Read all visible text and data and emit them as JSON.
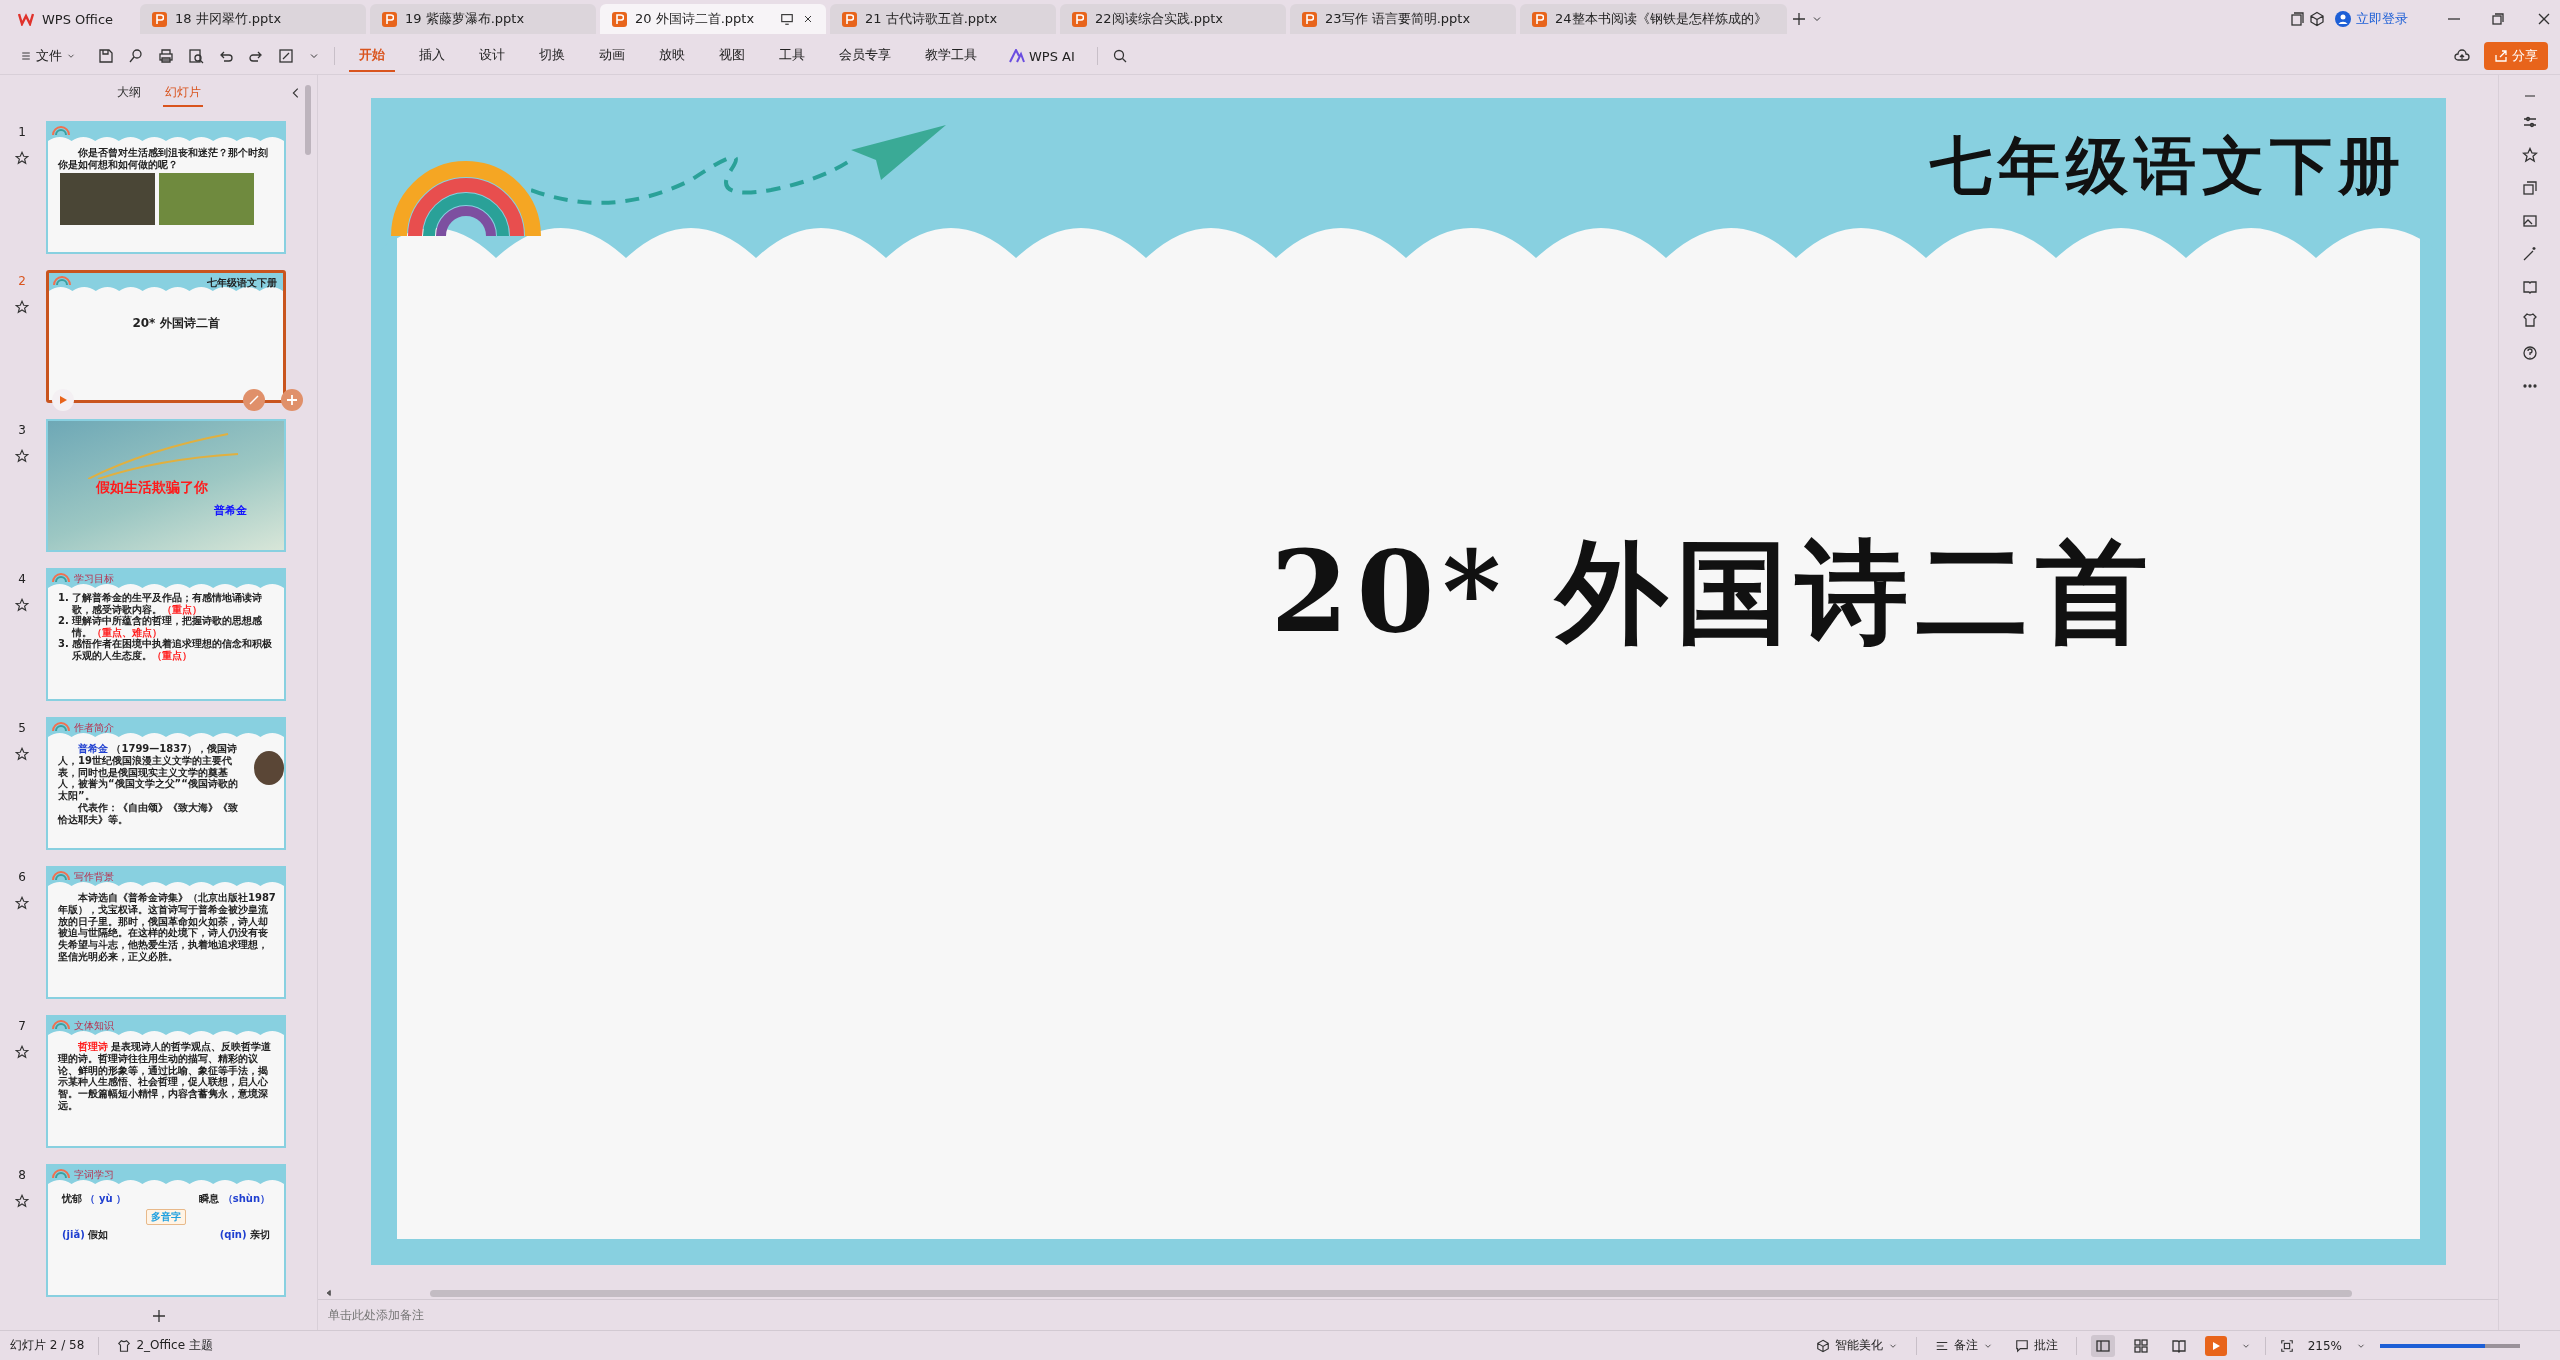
{
  "tabs": [
    {
      "kind": "home",
      "label": "WPS Office",
      "selected": false
    },
    {
      "kind": "pptx",
      "label": "18 井冈翠竹.pptx",
      "selected": false
    },
    {
      "kind": "pptx",
      "label": "19 紫藤萝瀑布.pptx",
      "selected": false
    },
    {
      "kind": "pptx",
      "label": "20 外国诗二首.pptx",
      "selected": true
    },
    {
      "kind": "pptx",
      "label": "21 古代诗歌五首.pptx",
      "selected": false
    },
    {
      "kind": "pptx",
      "label": "22阅读综合实践.pptx",
      "selected": false
    },
    {
      "kind": "pptx",
      "label": "23写作 语言要简明.pptx",
      "selected": false
    },
    {
      "kind": "pptx",
      "label": "24整本书阅读《钢铁是怎样炼成的》",
      "selected": false
    }
  ],
  "account": {
    "label": "立即登录"
  },
  "share_button": {
    "label": "分享"
  },
  "menu": {
    "file": "文件",
    "tabs": [
      {
        "label": "开始",
        "selected": true
      },
      {
        "label": "插入",
        "selected": false
      },
      {
        "label": "设计",
        "selected": false
      },
      {
        "label": "切换",
        "selected": false
      },
      {
        "label": "动画",
        "selected": false
      },
      {
        "label": "放映",
        "selected": false
      },
      {
        "label": "视图",
        "selected": false
      },
      {
        "label": "工具",
        "selected": false
      },
      {
        "label": "会员专享",
        "selected": false
      },
      {
        "label": "教学工具",
        "selected": false
      }
    ],
    "ai": "WPS AI"
  },
  "panel": {
    "tabs": [
      {
        "label": "大纲",
        "selected": false
      },
      {
        "label": "幻灯片",
        "selected": true
      }
    ],
    "slides": [
      {
        "number": "1",
        "kind": "intro",
        "selected": false,
        "text": "你是否曾对生活感到沮丧和迷茫？那个时刻你是如何想和如何做的呢？"
      },
      {
        "number": "2",
        "kind": "title",
        "selected": true,
        "header": "七年级语文下册",
        "title": "20* 外国诗二首"
      },
      {
        "number": "3",
        "kind": "cover",
        "selected": false,
        "title": "假如生活欺骗了你",
        "author": "普希金"
      },
      {
        "number": "4",
        "kind": "objectives",
        "selected": false,
        "header": "学习目标",
        "items": [
          {
            "num": "1.",
            "text": "了解普希金的生平及作品；有感情地诵读诗歌，感受诗歌内容。",
            "note": "（重点）"
          },
          {
            "num": "2.",
            "text": "理解诗中所蕴含的哲理，把握诗歌的思想感情。",
            "note": "（重点、难点）"
          },
          {
            "num": "3.",
            "text": "感悟作者在困境中执着追求理想的信念和积极乐观的人生态度。",
            "note": "（重点）"
          }
        ]
      },
      {
        "number": "5",
        "kind": "text",
        "selected": false,
        "header": "作者简介",
        "portrait": true,
        "paragraphs": [
          {
            "lead": "普希金",
            "color": "#1f3fd0",
            "text": "（1799—1837），俄国诗人，19世纪俄国浪漫主义文学的主要代表，同时也是俄国现实主义文学的奠基人，被誉为“俄国文学之父”“俄国诗歌的太阳”。"
          },
          {
            "text": "代表作：《自由颂》《致大海》《致恰达耶夫》等。"
          }
        ]
      },
      {
        "number": "6",
        "kind": "text",
        "selected": false,
        "header": "写作背景",
        "portrait": false,
        "paragraphs": [
          {
            "text": "本诗选自《普希金诗集》（北京出版社1987年版），戈宝权译。这首诗写于普希金被沙皇流放的日子里。那时，俄国革命如火如荼，诗人却被迫与世隔绝。在这样的处境下，诗人仍没有丧失希望与斗志，他热爱生活，执着地追求理想，坚信光明必来，正义必胜。"
          }
        ]
      },
      {
        "number": "7",
        "kind": "text",
        "selected": false,
        "header": "文体知识",
        "portrait": false,
        "paragraphs": [
          {
            "lead": "哲理诗",
            "color": "#ff1a1a",
            "text": "是表现诗人的哲学观点、反映哲学道理的诗。哲理诗往往用生动的描写、精彩的议论、鲜明的形象等，通过比喻、象征等手法，揭示某种人生感悟、社会哲理，促人联想，启人心智。一般篇幅短小精悍，内容含蓄隽永，意境深远。"
          }
        ]
      },
      {
        "number": "8",
        "kind": "vocab",
        "selected": false,
        "header": "字词学习",
        "words": [
          {
            "text": "忧郁",
            "pinyin": "（ yù ）"
          },
          {
            "text": "瞬息",
            "pinyin": "（shùn）"
          }
        ],
        "tag": "多音字",
        "readings": [
          {
            "pinyin": "(jiǎ)",
            "text": "假如"
          },
          {
            "pinyin": "(qīn)",
            "text": "亲切"
          }
        ]
      }
    ]
  },
  "slide": {
    "header": "七年级语文下册",
    "title": "20* 外国诗二首"
  },
  "notes": {
    "placeholder": "单击此处添加备注"
  },
  "status_bar": {
    "slide_count": "幻灯片 2 / 58",
    "theme": "2_Office 主题",
    "beautify": "智能美化",
    "notes": "备注",
    "comments": "批注",
    "views": [
      {
        "kind": "normal",
        "selected": true
      },
      {
        "kind": "sorter",
        "selected": false
      },
      {
        "kind": "reading",
        "selected": false
      }
    ],
    "zoom": "215%",
    "zoom_slider": {
      "level": 0.75
    }
  }
}
